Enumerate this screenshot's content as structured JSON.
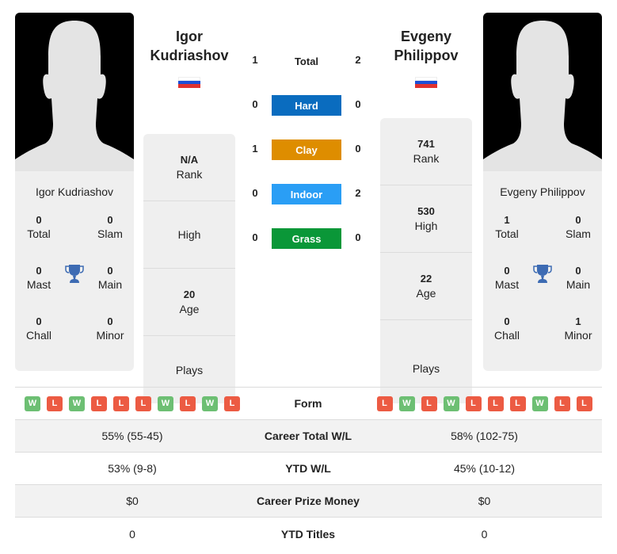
{
  "player1": {
    "name_line1": "Igor",
    "name_line2": "Kudriashov",
    "full_name": "Igor Kudriashov",
    "flag": "russia-flag",
    "titles": {
      "total": {
        "value": "0",
        "label": "Total"
      },
      "slam": {
        "value": "0",
        "label": "Slam"
      },
      "mast": {
        "value": "0",
        "label": "Mast"
      },
      "main": {
        "value": "0",
        "label": "Main"
      },
      "chall": {
        "value": "0",
        "label": "Chall"
      },
      "minor": {
        "value": "0",
        "label": "Minor"
      }
    },
    "stats": {
      "rank": {
        "value": "N/A",
        "label": "Rank"
      },
      "high": {
        "value": "",
        "label": "High"
      },
      "age": {
        "value": "20",
        "label": "Age"
      },
      "plays": {
        "value": "",
        "label": "Plays"
      }
    }
  },
  "player2": {
    "name_line1": "Evgeny",
    "name_line2": "Philippov",
    "full_name": "Evgeny Philippov",
    "flag": "russia-flag",
    "titles": {
      "total": {
        "value": "1",
        "label": "Total"
      },
      "slam": {
        "value": "0",
        "label": "Slam"
      },
      "mast": {
        "value": "0",
        "label": "Mast"
      },
      "main": {
        "value": "0",
        "label": "Main"
      },
      "chall": {
        "value": "0",
        "label": "Chall"
      },
      "minor": {
        "value": "1",
        "label": "Minor"
      }
    },
    "stats": {
      "rank": {
        "value": "741",
        "label": "Rank"
      },
      "high": {
        "value": "530",
        "label": "High"
      },
      "age": {
        "value": "22",
        "label": "Age"
      },
      "plays": {
        "value": "",
        "label": "Plays"
      }
    }
  },
  "h2h": {
    "total": {
      "label": "Total",
      "p1": "1",
      "p2": "2"
    },
    "surfaces": [
      {
        "label": "Hard",
        "p1": "0",
        "p2": "0",
        "color": "#0a6cbf"
      },
      {
        "label": "Clay",
        "p1": "1",
        "p2": "0",
        "color": "#de8d00"
      },
      {
        "label": "Indoor",
        "p1": "0",
        "p2": "2",
        "color": "#2a9ef5"
      },
      {
        "label": "Grass",
        "p1": "0",
        "p2": "0",
        "color": "#0a9738"
      }
    ]
  },
  "comparison": {
    "form": {
      "label": "Form",
      "p1": [
        "W",
        "L",
        "W",
        "L",
        "L",
        "L",
        "W",
        "L",
        "W",
        "L"
      ],
      "p2": [
        "L",
        "W",
        "L",
        "W",
        "L",
        "L",
        "L",
        "W",
        "L",
        "L"
      ]
    },
    "rows": [
      {
        "label": "Career Total W/L",
        "p1": "55% (55-45)",
        "p2": "58% (102-75)"
      },
      {
        "label": "YTD W/L",
        "p1": "53% (9-8)",
        "p2": "45% (10-12)"
      },
      {
        "label": "Career Prize Money",
        "p1": "$0",
        "p2": "$0"
      },
      {
        "label": "YTD Titles",
        "p1": "0",
        "p2": "0"
      }
    ]
  },
  "colors": {
    "win": "#6dbf73",
    "loss": "#ec5b43",
    "trophy": "#3d6bb3",
    "flag_white": "#ffffff",
    "flag_blue": "#1c4fd6",
    "flag_red": "#e0322f"
  }
}
